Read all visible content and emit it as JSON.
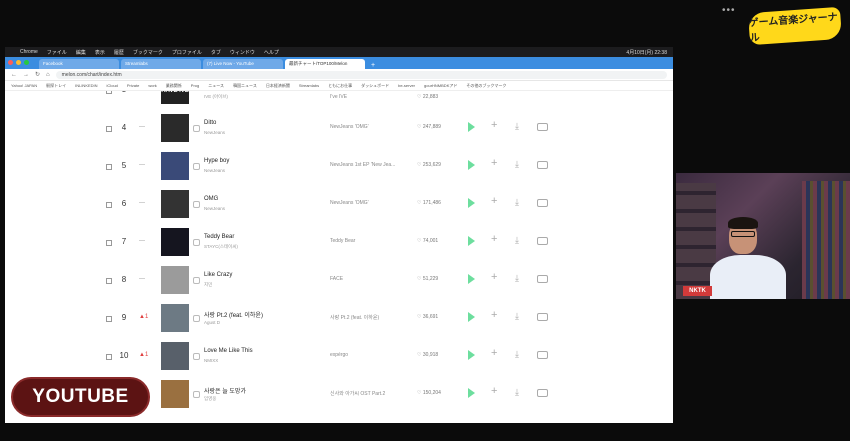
{
  "overlay": {
    "logo_text": "ゲーム音楽ジャーナル",
    "menu_dots": "•••",
    "webcam_name": "NKTK",
    "youtube_badge": "YOUTUBE"
  },
  "macbar": {
    "items": [
      "",
      "Chrome",
      "ファイル",
      "編集",
      "表示",
      "履歴",
      "ブックマーク",
      "プロファイル",
      "タブ",
      "ウィンドウ",
      "ヘルプ"
    ],
    "clock": "4月10日(月) 22:38"
  },
  "browser": {
    "tabs": [
      {
        "label": "Facebook",
        "active": false
      },
      {
        "label": "Streamlabs",
        "active": false
      },
      {
        "label": "(7) Live Now - YouTube",
        "active": false
      },
      {
        "label": "最新チャート/TOP100/Melon",
        "active": true
      }
    ],
    "url": "melon.com/chart/index.htm",
    "bookmarks": [
      "Yahoo! JAPAN",
      "駅探トレイ",
      "INLINKEDIN",
      "iCloud",
      "Private",
      "work",
      "業務関係",
      "Prog",
      "ニュース",
      "韓国ニュース",
      "日本経済新聞",
      "Streamlabs",
      "ともにお仕事",
      "ダッシュボード",
      "be-server",
      "gourHNMBDKアド",
      "その他のブックマーク"
    ]
  },
  "chart": {
    "partial_rank": "3",
    "partial_art_text": "IVE I HAVE IVE",
    "partial_artist": "IVE (아이브)",
    "partial_album": "I've IVE",
    "partial_likes": "♡ 22,883",
    "rows": [
      {
        "rank": "4",
        "move": "—",
        "move_dir": "none",
        "title": "Ditto",
        "artist": "NewJeans",
        "album": "NewJeans 'OMG'",
        "likes": "♡ 247,889",
        "art_color": "#2a2a2a"
      },
      {
        "rank": "5",
        "move": "—",
        "move_dir": "none",
        "title": "Hype boy",
        "artist": "NewJeans",
        "album": "NewJeans 1st EP 'New Jea...",
        "likes": "♡ 253,629",
        "art_color": "#3a4a78"
      },
      {
        "rank": "6",
        "move": "—",
        "move_dir": "none",
        "title": "OMG",
        "artist": "NewJeans",
        "album": "NewJeans 'OMG'",
        "likes": "♡ 171,486",
        "art_color": "#333333"
      },
      {
        "rank": "7",
        "move": "—",
        "move_dir": "none",
        "title": "Teddy Bear",
        "artist": "STAYC(스테이씨)",
        "album": "Teddy Bear",
        "likes": "♡ 74,001",
        "art_color": "#15151f"
      },
      {
        "rank": "8",
        "move": "—",
        "move_dir": "none",
        "title": "Like Crazy",
        "artist": "지민",
        "album": "FACE",
        "likes": "♡ 51,229",
        "art_color": "#9b9b9b"
      },
      {
        "rank": "9",
        "move": "▲1",
        "move_dir": "up",
        "title": "사랑 Pt.2 (feat. 이하윤)",
        "artist": "Agust D",
        "album": "사랑 Pt.2 (feat. 이하윤)",
        "likes": "♡ 36,691",
        "art_color": "#6d7a84"
      },
      {
        "rank": "10",
        "move": "▲1",
        "move_dir": "up",
        "title": "Love Me Like This",
        "artist": "NMIXX",
        "album": "expérgo",
        "likes": "♡ 30,918",
        "art_color": "#58606a"
      },
      {
        "rank": "",
        "move": "",
        "move_dir": "none",
        "title": "사랑은 늘 도망가",
        "artist": "임영웅",
        "album": "신사와 아가씨 OST Part.2",
        "likes": "♡ 150,204",
        "art_color": "#9a7040"
      }
    ]
  },
  "colors": {
    "play": "#2fd075",
    "tabbar": "#3b8de0",
    "rank_up": "#e04040"
  }
}
